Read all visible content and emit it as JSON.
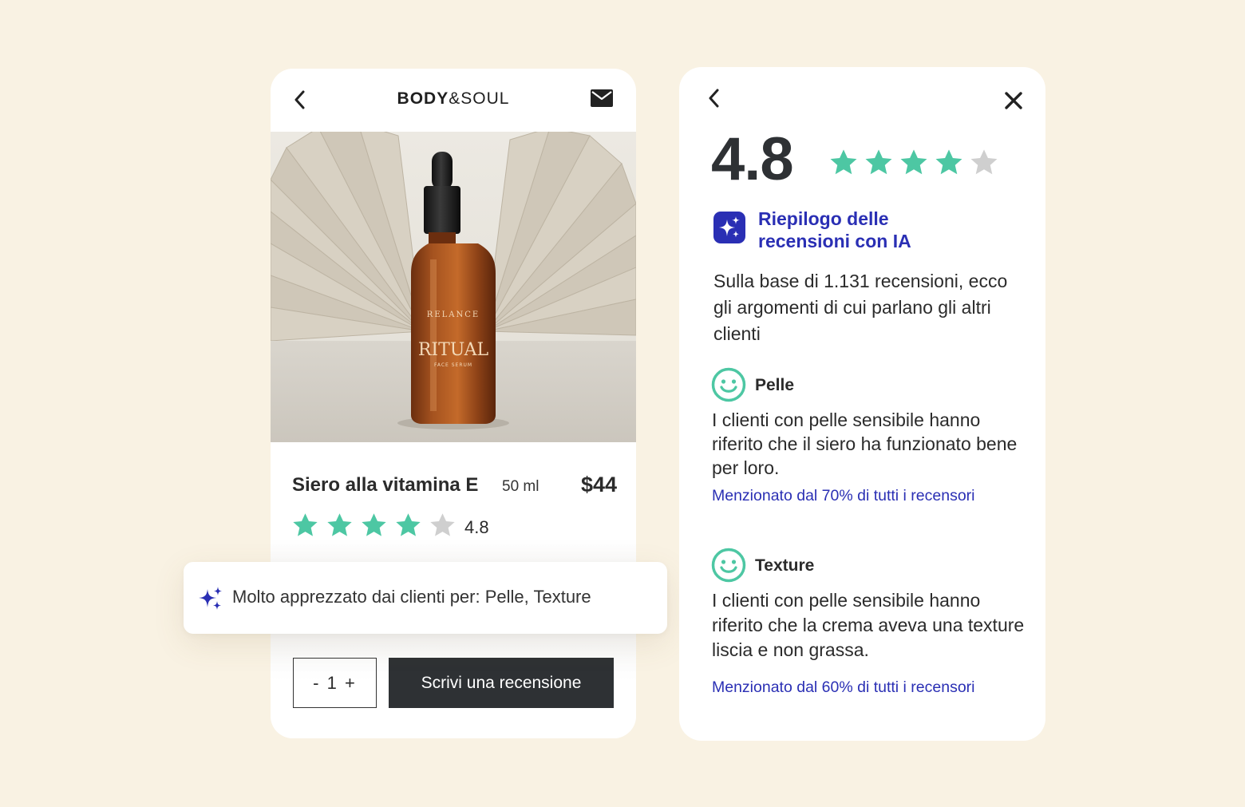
{
  "colors": {
    "background": "#f9f2e3",
    "star_filled": "#4dc7a3",
    "star_empty": "#cfcfcf",
    "accent_blue": "#2a2fb4",
    "button_dark": "#2e3134"
  },
  "product_page": {
    "header": {
      "back_icon": "chevron-left-icon",
      "brand_bold": "BODY",
      "brand_light": "&SOUL",
      "mail_icon": "mail-icon"
    },
    "photo": {
      "bottle_brand": "RELANCE",
      "bottle_name": "RITUAL",
      "bottle_subtitle": "FACE SERUM"
    },
    "name": "Siero alla vitamina E",
    "size": "50 ml",
    "price": "$44",
    "rating": "4.8",
    "stars_filled": 4,
    "stars_total": 5,
    "quantity_label": "- 1 +",
    "write_review_label": "Scrivi una recensione"
  },
  "highlight": {
    "icon": "sparkle-icon",
    "text": "Molto apprezzato dai clienti per: Pelle, Texture"
  },
  "reviews_panel": {
    "back_icon": "chevron-left-icon",
    "close_icon": "close-icon",
    "rating": "4.8",
    "stars_filled": 4,
    "stars_total": 5,
    "ai_title": "Riepilogo delle recensioni con IA",
    "ai_intro": "Sulla base di 1.131 recensioni, ecco gli argomenti di cui parlano gli altri clienti",
    "topics": [
      {
        "icon": "smiley-icon",
        "name": "Pelle",
        "description": "I clienti con pelle sensibile hanno riferito che il siero ha funzionato bene per loro.",
        "mention": "Menzionato dal 70% di tutti i recensori"
      },
      {
        "icon": "smiley-icon",
        "name": "Texture",
        "description": "I clienti con pelle sensibile hanno riferito che la crema aveva una texture liscia e non grassa.",
        "mention": "Menzionato dal 60% di tutti i recensori"
      }
    ]
  }
}
